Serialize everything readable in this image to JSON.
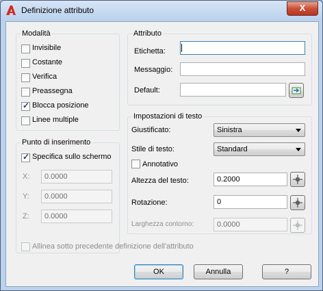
{
  "window": {
    "title": "Definizione attributo",
    "close_label": "X"
  },
  "modalita": {
    "title": "Modalità",
    "items": [
      {
        "label": "Invisibile",
        "checked": false
      },
      {
        "label": "Costante",
        "checked": false
      },
      {
        "label": "Verifica",
        "checked": false
      },
      {
        "label": "Preassegna",
        "checked": false
      },
      {
        "label": "Blocca posizione",
        "checked": true
      },
      {
        "label": "Linee multiple",
        "checked": false
      }
    ]
  },
  "punto": {
    "title": "Punto di inserimento",
    "specifica_label": "Specifica sullo schermo",
    "x_label": "X:",
    "x_value": "0.0000",
    "y_label": "Y:",
    "y_value": "0.0000",
    "z_label": "Z:",
    "z_value": "0.0000"
  },
  "attributo": {
    "title": "Attributo",
    "etichetta_label": "Etichetta:",
    "etichetta_value": "",
    "messaggio_label": "Messaggio:",
    "messaggio_value": "",
    "default_label": "Default:",
    "default_value": ""
  },
  "testo": {
    "title": "Impostazioni di testo",
    "giustificato_label": "Giustificato:",
    "giustificato_value": "Sinistra",
    "stile_label": "Stile di testo:",
    "stile_value": "Standard",
    "annotativo_label": "Annotativo",
    "altezza_label": "Altezza del testo:",
    "altezza_value": "0.2000",
    "rotazione_label": "Rotazione:",
    "rotazione_value": "0",
    "larghezza_label": "Larghezza contorno:",
    "larghezza_value": "0.0000"
  },
  "allinea_label": "Allinea sotto precedente definizione dell'attributo",
  "buttons": {
    "ok": "OK",
    "annulla": "Annulla",
    "help": "?"
  },
  "colors": {
    "accent": "#3c7fb1",
    "close": "#c9503a",
    "window_frame": "#bcd2ec"
  }
}
